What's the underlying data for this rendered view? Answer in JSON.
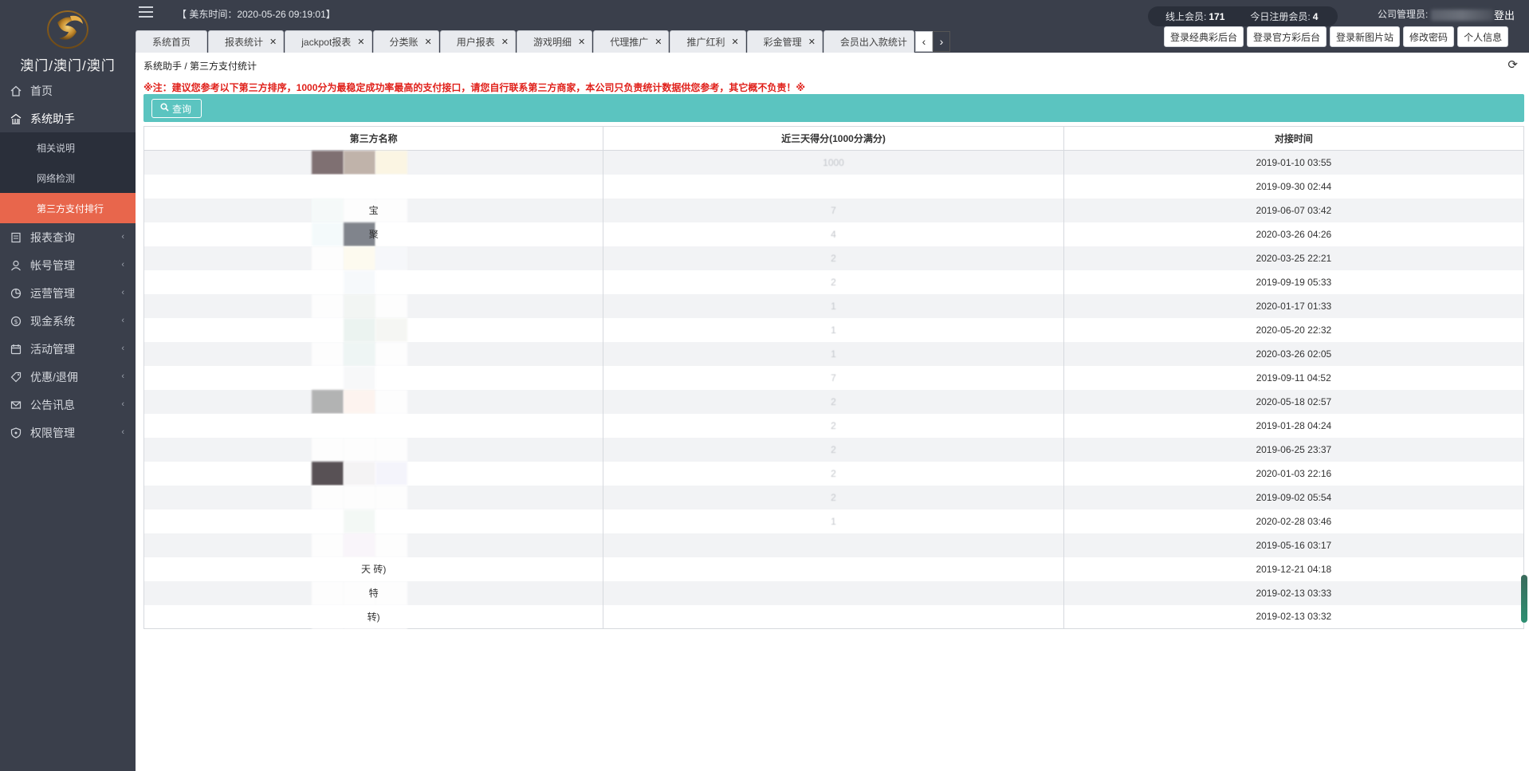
{
  "sidebar": {
    "brand": "澳门/澳门/澳门",
    "items": [
      {
        "label": "首页",
        "icon": "home-icon"
      },
      {
        "label": "系统助手",
        "icon": "building-icon",
        "open": true,
        "children": [
          "相关说明",
          "网络检测",
          "第三方支付排行"
        ]
      },
      {
        "label": "报表查询",
        "icon": "report-icon"
      },
      {
        "label": "帐号管理",
        "icon": "user-icon"
      },
      {
        "label": "运营管理",
        "icon": "operation-icon"
      },
      {
        "label": "现金系统",
        "icon": "cash-icon"
      },
      {
        "label": "活动管理",
        "icon": "activity-icon"
      },
      {
        "label": "优惠/退佣",
        "icon": "tag-icon"
      },
      {
        "label": "公告讯息",
        "icon": "mail-icon"
      },
      {
        "label": "权限管理",
        "icon": "shield-icon"
      }
    ]
  },
  "header": {
    "clock": "【 美东时间：2020-05-26 09:19:01】",
    "online_label": "线上会员:",
    "online_count": "171",
    "today_label": "今日注册会员:",
    "today_count": "4",
    "company_label": "公司管理员:",
    "logout": "登出",
    "buttons": [
      "登录经典彩后台",
      "登录官方彩后台",
      "登录新图片站",
      "修改密码",
      "个人信息"
    ]
  },
  "tabs": [
    "系统首页",
    "报表统计",
    "jackpot报表",
    "分类账",
    "用户报表",
    "游戏明细",
    "代理推广",
    "推广红利",
    "彩金管理",
    "会员出入款统计"
  ],
  "main": {
    "breadcrumb": "系统助手 / 第三方支付统计",
    "notice": "※注：建议您参考以下第三方排序，1000分为最稳定成功率最高的支付接口，请您自行联系第三方商家，本公司只负责统计数据供您参考，其它概不负责！※",
    "query_label": "查询",
    "table": {
      "headers": [
        "第三方名称",
        "近三天得分(1000分满分)",
        "对接时间"
      ],
      "rows": [
        {
          "name": "",
          "score": "1000",
          "time": "2019-01-10 03:55"
        },
        {
          "name": "",
          "score": "",
          "time": "2019-09-30 02:44"
        },
        {
          "name": "宝",
          "score": "7",
          "time": "2019-06-07 03:42"
        },
        {
          "name": "聚",
          "score": "4",
          "time": "2020-03-26 04:26"
        },
        {
          "name": "",
          "score": "2",
          "time": "2020-03-25 22:21"
        },
        {
          "name": "",
          "score": "2",
          "time": "2019-09-19 05:33"
        },
        {
          "name": "",
          "score": "1",
          "time": "2020-01-17 01:33"
        },
        {
          "name": "",
          "score": "1",
          "time": "2020-05-20 22:32"
        },
        {
          "name": "",
          "score": "1",
          "time": "2020-03-26 02:05"
        },
        {
          "name": "",
          "score": "7",
          "time": "2019-09-11 04:52"
        },
        {
          "name": "",
          "score": "2",
          "time": "2020-05-18 02:57"
        },
        {
          "name": "",
          "score": "2",
          "time": "2019-01-28 04:24"
        },
        {
          "name": "",
          "score": "2",
          "time": "2019-06-25 23:37"
        },
        {
          "name": "",
          "score": "2",
          "time": "2020-01-03 22:16"
        },
        {
          "name": "",
          "score": "2",
          "time": "2019-09-02 05:54"
        },
        {
          "name": "",
          "score": "1",
          "time": "2020-02-28 03:46"
        },
        {
          "name": "",
          "score": "",
          "time": "2019-05-16 03:17"
        },
        {
          "name": "天 砖)",
          "score": "",
          "time": "2019-12-21 04:18"
        },
        {
          "name": "特",
          "score": "",
          "time": "2019-02-13 03:33"
        },
        {
          "name": "转)",
          "score": "",
          "time": "2019-02-13 03:32"
        }
      ]
    }
  },
  "colors": {
    "sidebar": "#3a3f4b",
    "accent": "#e8664c",
    "toolbar": "#5bc4c0",
    "notice": "#e0201a"
  }
}
